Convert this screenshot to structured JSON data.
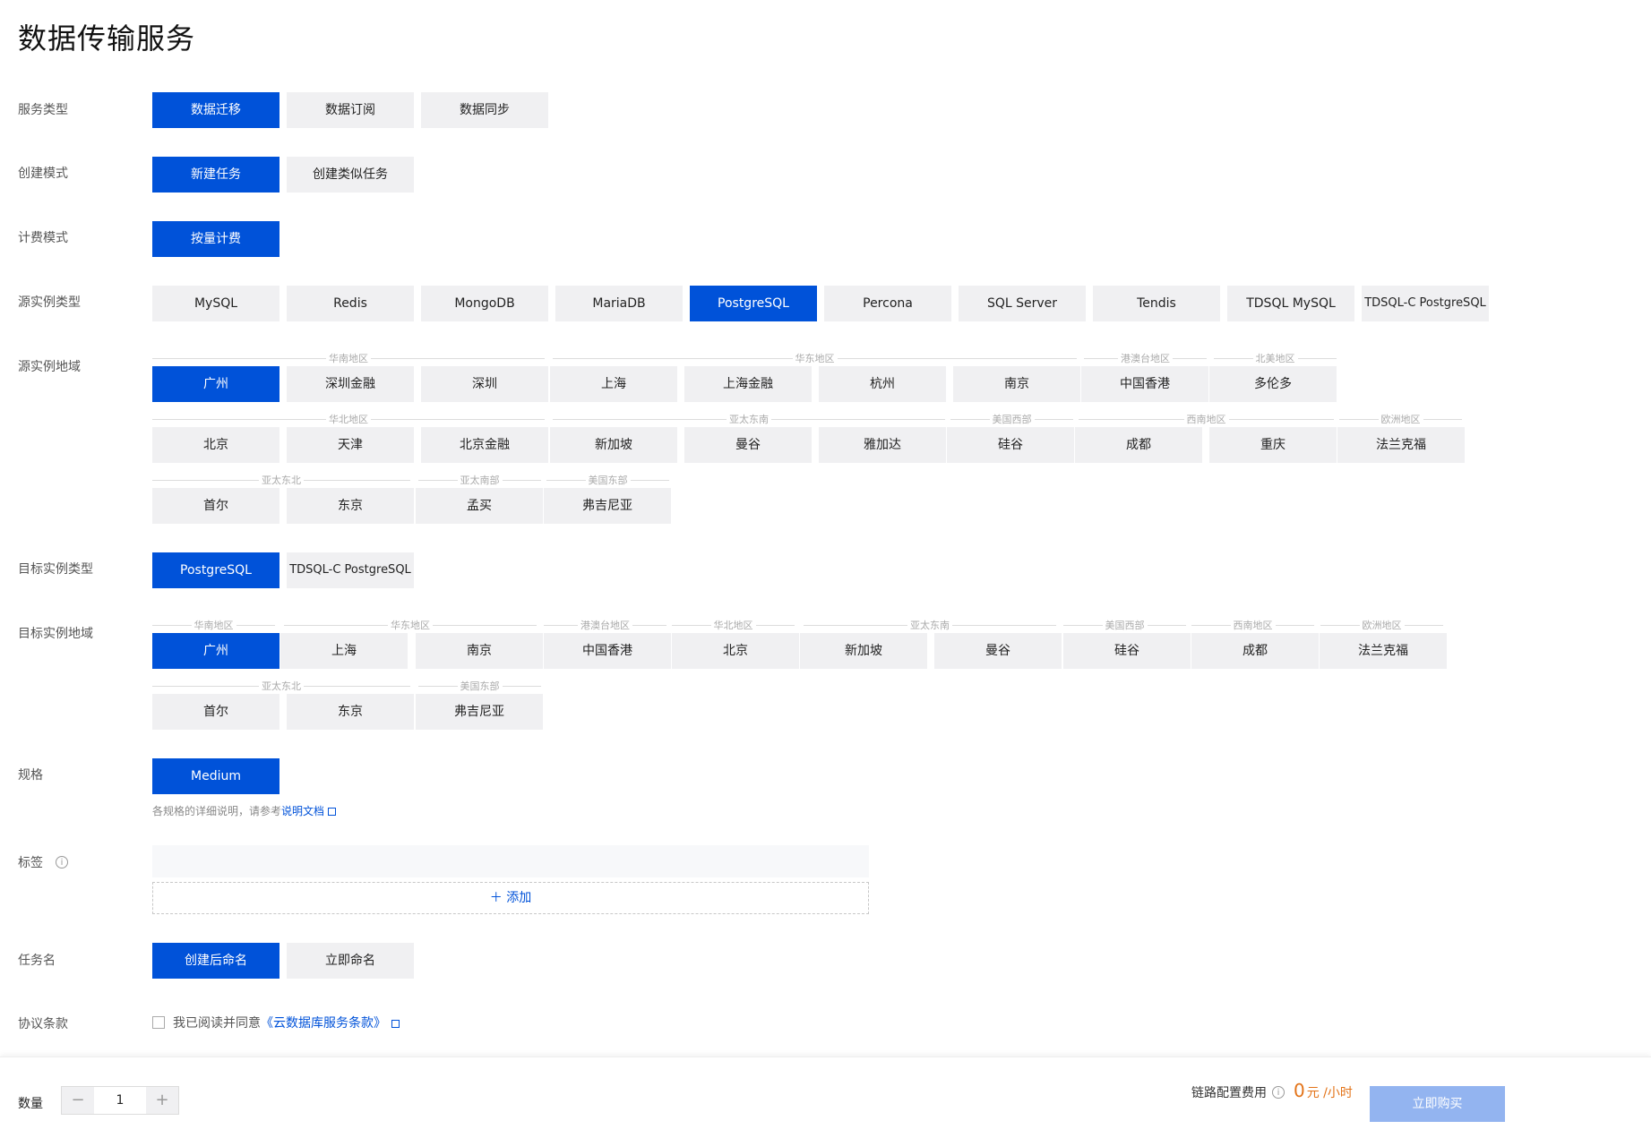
{
  "title": "数据传输服务",
  "labels": {
    "service_type": "服务类型",
    "create_mode": "创建模式",
    "billing_mode": "计费模式",
    "src_type": "源实例类型",
    "src_region": "源实例地域",
    "dst_type": "目标实例类型",
    "dst_region": "目标实例地域",
    "spec": "规格",
    "tags": "标签",
    "task_name": "任务名",
    "agreement": "协议条款"
  },
  "service_types": [
    {
      "label": "数据迁移",
      "selected": true
    },
    {
      "label": "数据订阅",
      "selected": false
    },
    {
      "label": "数据同步",
      "selected": false
    }
  ],
  "create_modes": [
    {
      "label": "新建任务",
      "selected": true
    },
    {
      "label": "创建类似任务",
      "selected": false
    }
  ],
  "billing_modes": [
    {
      "label": "按量计费",
      "selected": true
    }
  ],
  "src_types": [
    {
      "label": "MySQL",
      "selected": false
    },
    {
      "label": "Redis",
      "selected": false
    },
    {
      "label": "MongoDB",
      "selected": false
    },
    {
      "label": "MariaDB",
      "selected": false
    },
    {
      "label": "PostgreSQL",
      "selected": true
    },
    {
      "label": "Percona",
      "selected": false
    },
    {
      "label": "SQL Server",
      "selected": false
    },
    {
      "label": "Tendis",
      "selected": false
    },
    {
      "label": "TDSQL MySQL",
      "selected": false
    },
    {
      "label": "TDSQL-C PostgreSQL",
      "selected": false
    }
  ],
  "src_region_groups": [
    {
      "name": "华南地区",
      "regions": [
        {
          "label": "广州",
          "selected": true
        },
        {
          "label": "深圳金融"
        },
        {
          "label": "深圳"
        }
      ]
    },
    {
      "name": "华东地区",
      "regions": [
        {
          "label": "上海"
        },
        {
          "label": "上海金融"
        },
        {
          "label": "杭州"
        },
        {
          "label": "南京"
        }
      ]
    },
    {
      "name": "港澳台地区",
      "regions": [
        {
          "label": "中国香港"
        }
      ]
    },
    {
      "name": "北美地区",
      "regions": [
        {
          "label": "多伦多"
        }
      ]
    },
    {
      "name": "华北地区",
      "regions": [
        {
          "label": "北京"
        },
        {
          "label": "天津"
        },
        {
          "label": "北京金融"
        }
      ]
    },
    {
      "name": "亚太东南",
      "regions": [
        {
          "label": "新加坡"
        },
        {
          "label": "曼谷"
        },
        {
          "label": "雅加达"
        }
      ]
    },
    {
      "name": "美国西部",
      "regions": [
        {
          "label": "硅谷"
        }
      ]
    },
    {
      "name": "西南地区",
      "regions": [
        {
          "label": "成都"
        },
        {
          "label": "重庆"
        }
      ]
    },
    {
      "name": "欧洲地区",
      "regions": [
        {
          "label": "法兰克福"
        }
      ]
    },
    {
      "name": "亚太东北",
      "regions": [
        {
          "label": "首尔"
        },
        {
          "label": "东京"
        }
      ]
    },
    {
      "name": "亚太南部",
      "regions": [
        {
          "label": "孟买"
        }
      ]
    },
    {
      "name": "美国东部",
      "regions": [
        {
          "label": "弗吉尼亚"
        }
      ]
    }
  ],
  "dst_types": [
    {
      "label": "PostgreSQL",
      "selected": true
    },
    {
      "label": "TDSQL-C PostgreSQL",
      "selected": false
    }
  ],
  "dst_region_groups": [
    {
      "name": "华南地区",
      "regions": [
        {
          "label": "广州",
          "selected": true
        }
      ]
    },
    {
      "name": "华东地区",
      "regions": [
        {
          "label": "上海"
        },
        {
          "label": "南京"
        }
      ]
    },
    {
      "name": "港澳台地区",
      "regions": [
        {
          "label": "中国香港"
        }
      ]
    },
    {
      "name": "华北地区",
      "regions": [
        {
          "label": "北京"
        }
      ]
    },
    {
      "name": "亚太东南",
      "regions": [
        {
          "label": "新加坡"
        },
        {
          "label": "曼谷"
        }
      ]
    },
    {
      "name": "美国西部",
      "regions": [
        {
          "label": "硅谷"
        }
      ]
    },
    {
      "name": "西南地区",
      "regions": [
        {
          "label": "成都"
        }
      ]
    },
    {
      "name": "欧洲地区",
      "regions": [
        {
          "label": "法兰克福"
        }
      ]
    },
    {
      "name": "亚太东北",
      "regions": [
        {
          "label": "首尔"
        },
        {
          "label": "东京"
        }
      ]
    },
    {
      "name": "美国东部",
      "regions": [
        {
          "label": "弗吉尼亚"
        }
      ]
    }
  ],
  "specs": [
    {
      "label": "Medium",
      "selected": true
    }
  ],
  "spec_hint": {
    "text": "各规格的详细说明，请参考",
    "link": "说明文档"
  },
  "tags": {
    "add_label": "添加"
  },
  "task_names": [
    {
      "label": "创建后命名",
      "selected": true
    },
    {
      "label": "立即命名",
      "selected": false
    }
  ],
  "agreement": {
    "text": "我已阅读并同意",
    "link": "《云数据库服务条款》",
    "checked": false
  },
  "footer": {
    "qty_label": "数量",
    "qty_value": "1",
    "minus": "−",
    "plus": "+",
    "fee_label": "链路配置费用",
    "price": "0",
    "price_unit": "元 /小时",
    "buy_label": "立即购买"
  },
  "colors": {
    "accent": "#0052d9",
    "price": "#e37318",
    "buy_disabled": "#93b4f0"
  }
}
